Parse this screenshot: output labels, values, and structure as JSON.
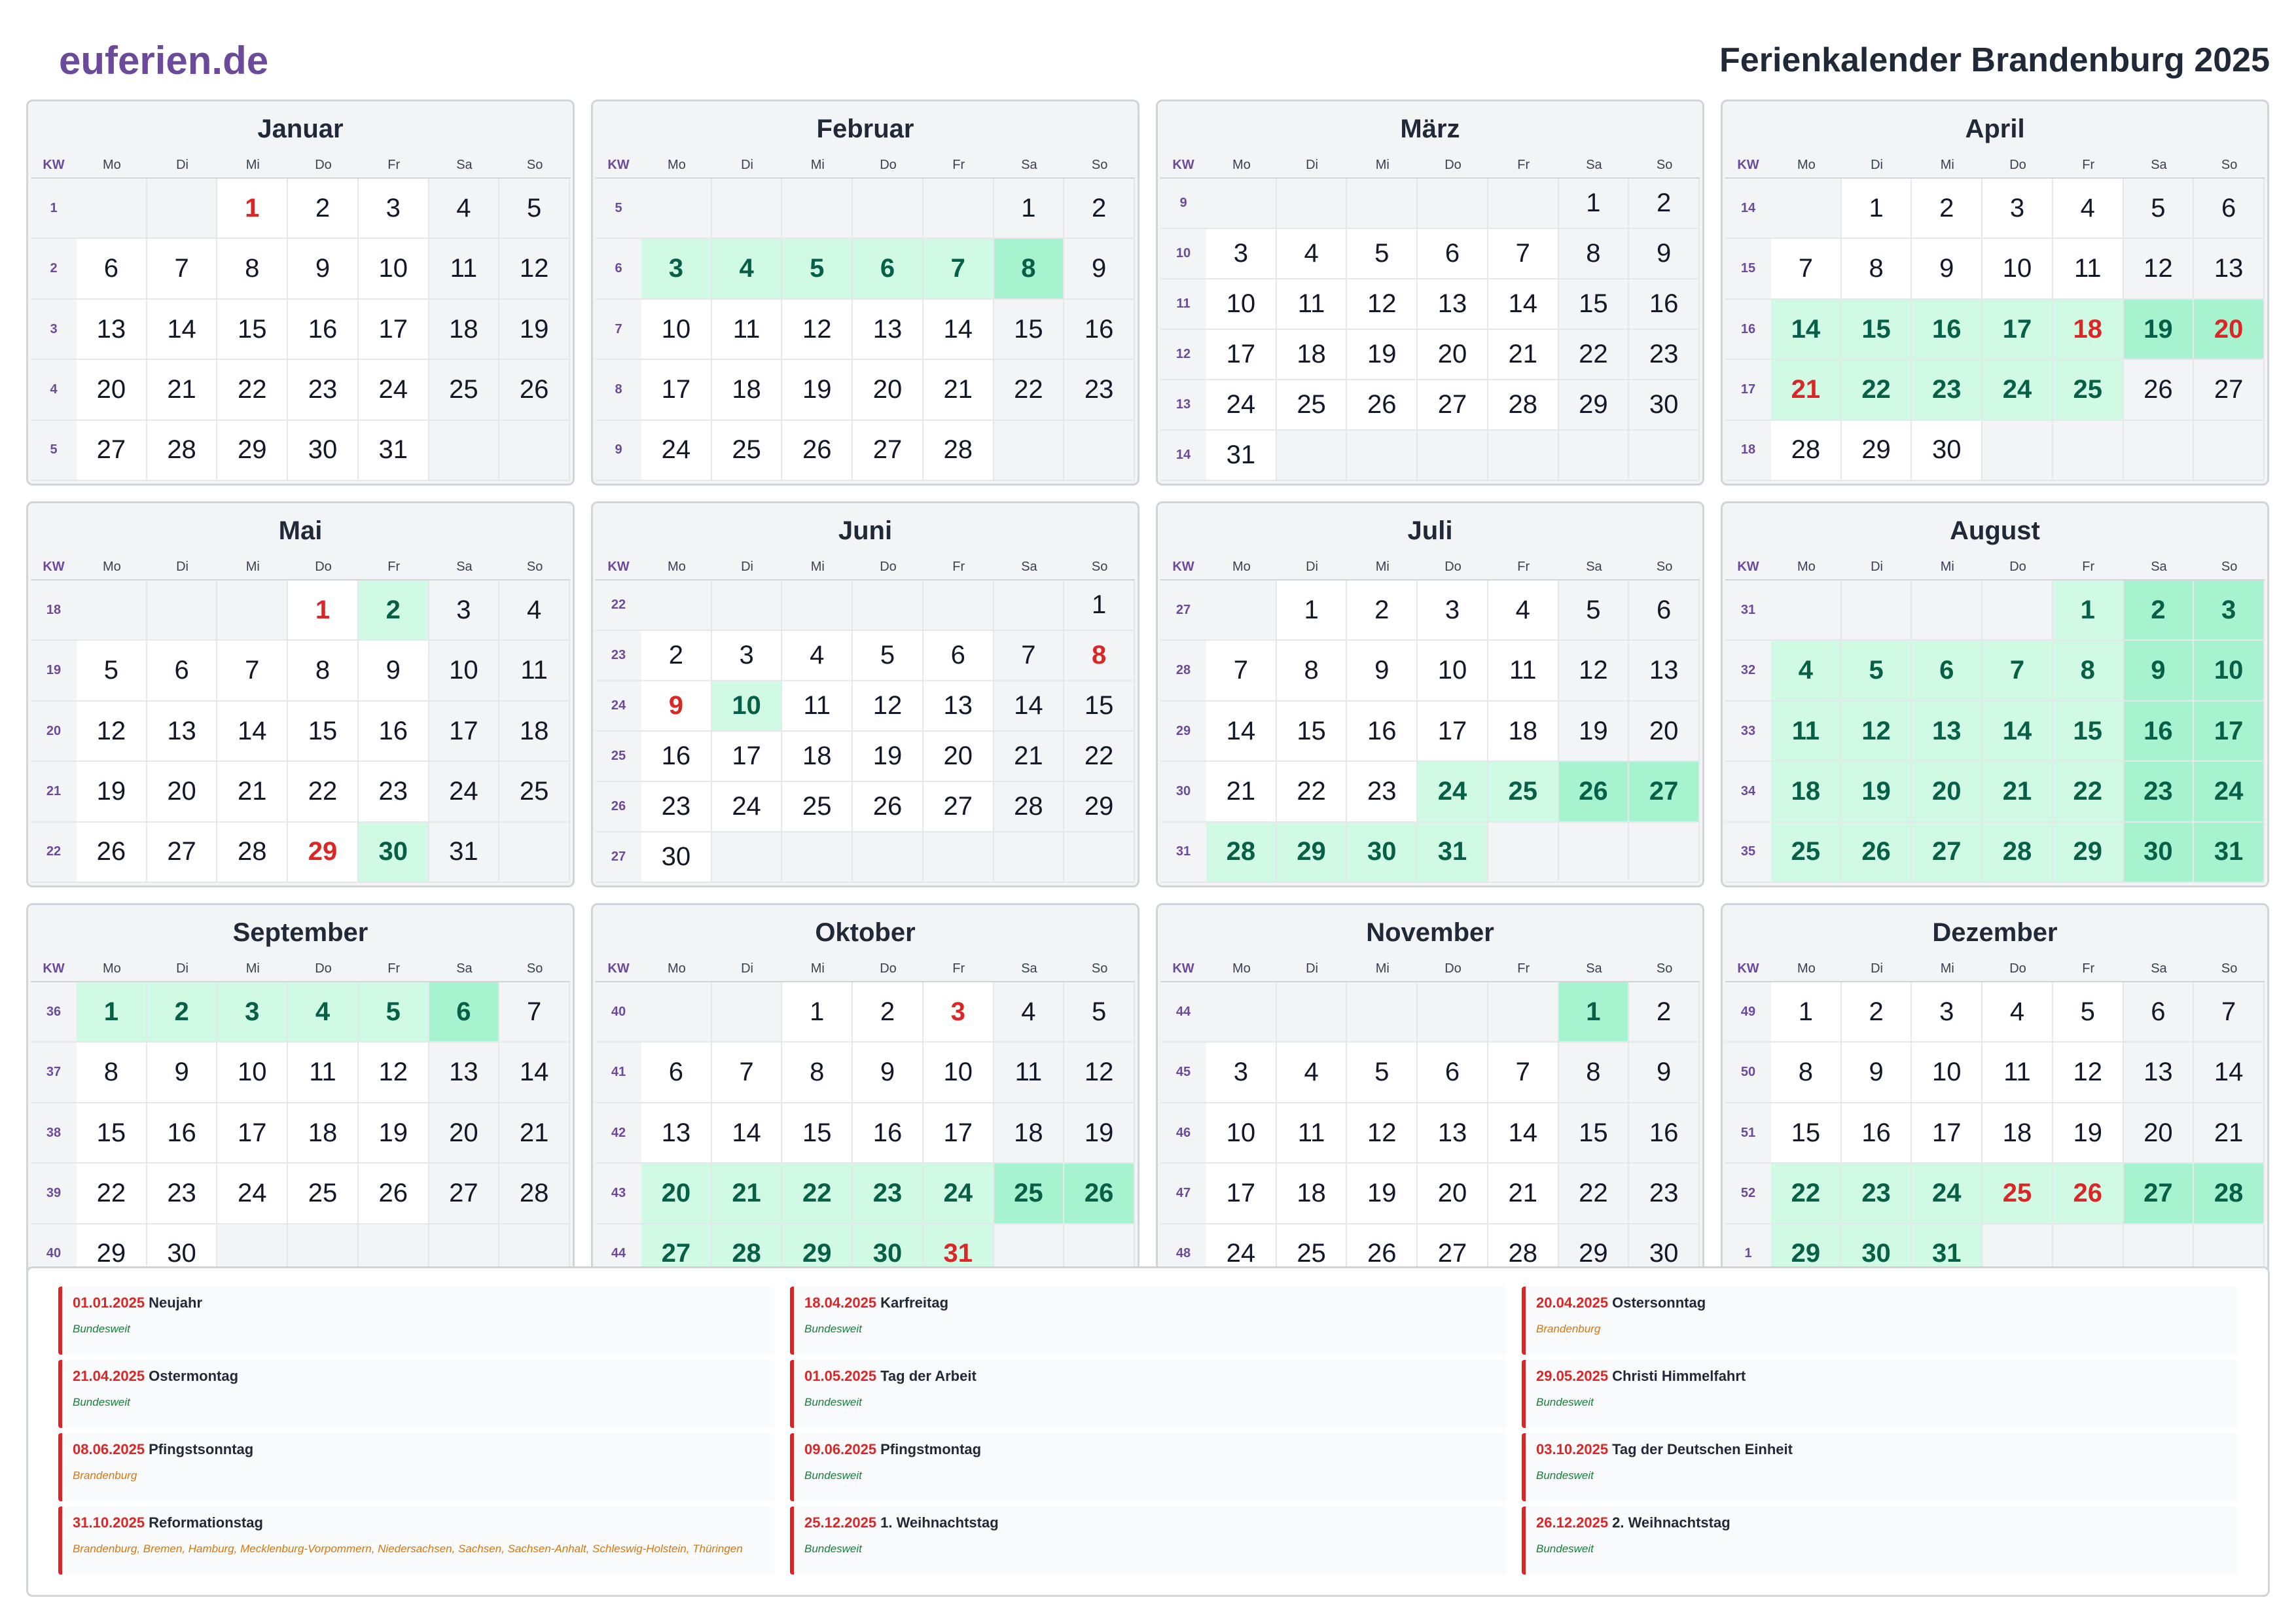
{
  "header": {
    "logo": "euferien.de",
    "title": "Ferienkalender Brandenburg 2025"
  },
  "colors": {
    "brand": "#6b4a9c",
    "holiday": "#dc2626",
    "vacation": "#d1fae5",
    "vacation_weekend": "#a7f3d0"
  },
  "weekday_header": {
    "kw": "KW",
    "days": [
      "Mo",
      "Di",
      "Mi",
      "Do",
      "Fr",
      "Sa",
      "So"
    ]
  },
  "months": [
    {
      "name": "Januar",
      "offset": 2,
      "days": 31,
      "kw": [
        1,
        2,
        3,
        4,
        5
      ],
      "holidays": [
        1
      ],
      "vacation": []
    },
    {
      "name": "Februar",
      "offset": 5,
      "days": 28,
      "kw": [
        5,
        6,
        7,
        8,
        9
      ],
      "holidays": [],
      "vacation": [
        3,
        4,
        5,
        6,
        7,
        8
      ]
    },
    {
      "name": "März",
      "offset": 5,
      "days": 31,
      "kw": [
        9,
        10,
        11,
        12,
        13,
        14
      ],
      "holidays": [],
      "vacation": []
    },
    {
      "name": "April",
      "offset": 1,
      "days": 30,
      "kw": [
        14,
        15,
        16,
        17,
        18
      ],
      "holidays": [
        18,
        20,
        21
      ],
      "vacation": [
        14,
        15,
        16,
        17,
        18,
        19,
        20,
        21,
        22,
        23,
        24,
        25
      ]
    },
    {
      "name": "Mai",
      "offset": 3,
      "days": 31,
      "kw": [
        18,
        19,
        20,
        21,
        22
      ],
      "holidays": [
        1,
        29
      ],
      "vacation": [
        2,
        30
      ]
    },
    {
      "name": "Juni",
      "offset": 6,
      "days": 30,
      "kw": [
        22,
        23,
        24,
        25,
        26,
        27
      ],
      "holidays": [
        8,
        9
      ],
      "vacation": [
        10
      ]
    },
    {
      "name": "Juli",
      "offset": 1,
      "days": 31,
      "kw": [
        27,
        28,
        29,
        30,
        31
      ],
      "holidays": [],
      "vacation": [
        24,
        25,
        26,
        27,
        28,
        29,
        30,
        31
      ]
    },
    {
      "name": "August",
      "offset": 4,
      "days": 31,
      "kw": [
        31,
        32,
        33,
        34,
        35
      ],
      "holidays": [],
      "vacation": [
        1,
        2,
        3,
        4,
        5,
        6,
        7,
        8,
        9,
        10,
        11,
        12,
        13,
        14,
        15,
        16,
        17,
        18,
        19,
        20,
        21,
        22,
        23,
        24,
        25,
        26,
        27,
        28,
        29,
        30,
        31
      ]
    },
    {
      "name": "September",
      "offset": 0,
      "days": 30,
      "kw": [
        36,
        37,
        38,
        39,
        40
      ],
      "holidays": [],
      "vacation": [
        1,
        2,
        3,
        4,
        5,
        6
      ]
    },
    {
      "name": "Oktober",
      "offset": 2,
      "days": 31,
      "kw": [
        40,
        41,
        42,
        43,
        44
      ],
      "holidays": [
        3,
        31
      ],
      "vacation": [
        20,
        21,
        22,
        23,
        24,
        25,
        26,
        27,
        28,
        29,
        30,
        31
      ]
    },
    {
      "name": "November",
      "offset": 5,
      "days": 30,
      "kw": [
        44,
        45,
        46,
        47,
        48
      ],
      "holidays": [],
      "vacation": [
        1
      ]
    },
    {
      "name": "Dezember",
      "offset": 0,
      "days": 31,
      "kw": [
        49,
        50,
        51,
        52,
        1
      ],
      "holidays": [
        25,
        26
      ],
      "vacation": [
        22,
        23,
        24,
        25,
        26,
        27,
        28,
        29,
        30,
        31
      ]
    }
  ],
  "holidays": [
    {
      "date": "01.01.2025",
      "name": "Neujahr",
      "region": "Bundesweit",
      "scope": "all"
    },
    {
      "date": "18.04.2025",
      "name": "Karfreitag",
      "region": "Bundesweit",
      "scope": "all"
    },
    {
      "date": "20.04.2025",
      "name": "Ostersonntag",
      "region": "Brandenburg",
      "scope": "state"
    },
    {
      "date": "21.04.2025",
      "name": "Ostermontag",
      "region": "Bundesweit",
      "scope": "all"
    },
    {
      "date": "01.05.2025",
      "name": "Tag der Arbeit",
      "region": "Bundesweit",
      "scope": "all"
    },
    {
      "date": "29.05.2025",
      "name": "Christi Himmelfahrt",
      "region": "Bundesweit",
      "scope": "all"
    },
    {
      "date": "08.06.2025",
      "name": "Pfingstsonntag",
      "region": "Brandenburg",
      "scope": "state"
    },
    {
      "date": "09.06.2025",
      "name": "Pfingstmontag",
      "region": "Bundesweit",
      "scope": "all"
    },
    {
      "date": "03.10.2025",
      "name": "Tag der Deutschen Einheit",
      "region": "Bundesweit",
      "scope": "all"
    },
    {
      "date": "31.10.2025",
      "name": "Reformationstag",
      "region": "Brandenburg, Bremen, Hamburg, Mecklenburg-Vorpommern, Niedersachsen, Sachsen, Sachsen-Anhalt, Schleswig-Holstein, Thüringen",
      "scope": "state"
    },
    {
      "date": "25.12.2025",
      "name": "1. Weihnachtstag",
      "region": "Bundesweit",
      "scope": "all"
    },
    {
      "date": "26.12.2025",
      "name": "2. Weihnachtstag",
      "region": "Bundesweit",
      "scope": "all"
    }
  ]
}
